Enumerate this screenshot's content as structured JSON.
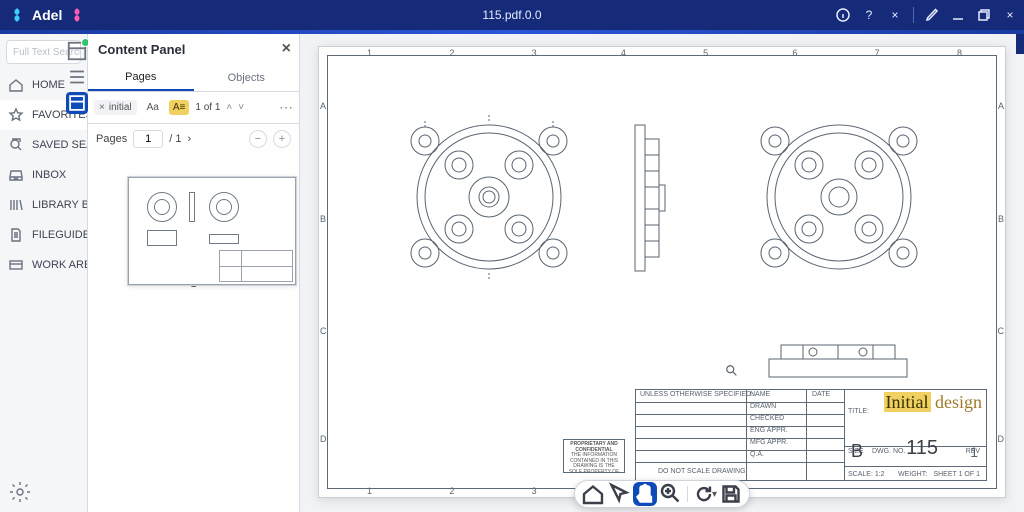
{
  "titlebar": {
    "app_short": "Adel",
    "doc_title": "115.pdf.0.0"
  },
  "rail": {
    "search_placeholder": "Full Text Search",
    "items": [
      {
        "label": "HOME"
      },
      {
        "label": "FAVORITES"
      },
      {
        "label": "SAVED SEARCH"
      },
      {
        "label": "INBOX"
      },
      {
        "label": "LIBRARY BROWSE"
      },
      {
        "label": "FILEGUIDE"
      },
      {
        "label": "WORK AREA"
      }
    ]
  },
  "content_panel": {
    "title": "Content Panel",
    "tabs": {
      "pages": "Pages",
      "objects": "Objects"
    },
    "search": {
      "chip": "initial",
      "case_label": "Aa",
      "word_label": "A≡",
      "count": "1 of 1"
    },
    "nav": {
      "label": "Pages",
      "current": "1",
      "total": "/ 1"
    },
    "thumb_caption": "1"
  },
  "drawing": {
    "frame_numbers": [
      "1",
      "2",
      "3",
      "4",
      "5",
      "6",
      "7",
      "8"
    ],
    "frame_letters": [
      "A",
      "B",
      "C",
      "D"
    ],
    "proprietary_header": "PROPRIETARY AND CONFIDENTIAL",
    "proprietary_body": "THE INFORMATION CONTAINED IN THIS DRAWING IS THE SOLE PROPERTY OF",
    "do_not_scale": "DO NOT SCALE DRAWING",
    "spec_header": "UNLESS OTHERWISE SPECIFIED:",
    "labels": {
      "name": "NAME",
      "date": "DATE",
      "drawn": "DRAWN",
      "checked": "CHECKED",
      "engappr": "ENG APPR.",
      "mfgappr": "MFG APPR.",
      "qa": "Q.A.",
      "title": "TITLE:",
      "size": "SIZE",
      "dwgno": "DWG. NO.",
      "rev": "REV",
      "scale": "SCALE: 1:2",
      "weight": "WEIGHT:",
      "sheet": "SHEET 1 OF 1"
    },
    "project_pre": "Initial",
    "project_post": " design",
    "size_value": "B",
    "dwg_number": "115",
    "rev_value": "1"
  }
}
